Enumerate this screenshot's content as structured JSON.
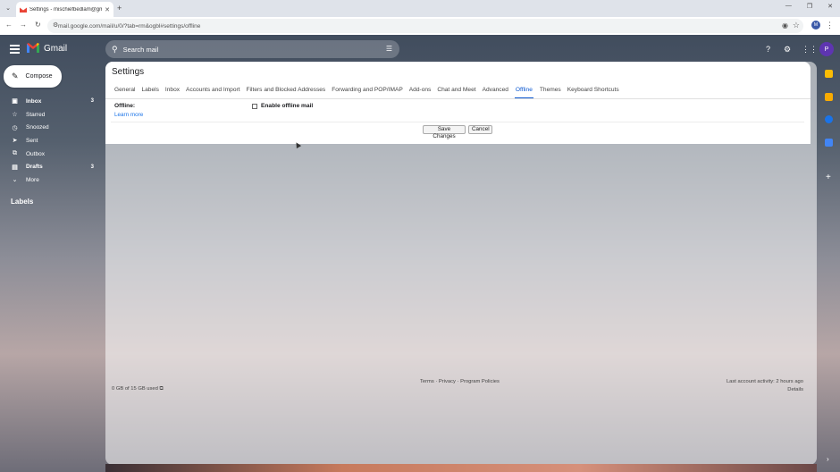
{
  "browser": {
    "tab_title": "Settings - mischiefbedlam@gm",
    "url": "mail.google.com/mail/u/0/?tab=rm&ogbl#settings/offline",
    "profile_initial": "M"
  },
  "gmail": {
    "product_name": "Gmail",
    "search_placeholder": "Search mail",
    "avatar_initial": "P",
    "compose_label": "Compose"
  },
  "nav": {
    "items": [
      {
        "label": "Inbox",
        "count": "3",
        "icon": "inbox-icon"
      },
      {
        "label": "Starred",
        "count": "",
        "icon": "star-icon"
      },
      {
        "label": "Snoozed",
        "count": "",
        "icon": "clock-icon"
      },
      {
        "label": "Sent",
        "count": "",
        "icon": "send-icon"
      },
      {
        "label": "Outbox",
        "count": "",
        "icon": "outbox-icon"
      },
      {
        "label": "Drafts",
        "count": "3",
        "icon": "draft-icon"
      },
      {
        "label": "More",
        "count": "",
        "icon": "chevron-down-icon"
      }
    ],
    "labels_heading": "Labels"
  },
  "settings": {
    "title": "Settings",
    "tabs": [
      "General",
      "Labels",
      "Inbox",
      "Accounts and Import",
      "Filters and Blocked Addresses",
      "Forwarding and POP/IMAP",
      "Add-ons",
      "Chat and Meet",
      "Advanced",
      "Offline",
      "Themes",
      "Keyboard Shortcuts"
    ],
    "active_tab": "Offline",
    "offline_label": "Offline:",
    "learn_more": "Learn more",
    "enable_offline_label": "Enable offline mail",
    "enable_offline_checked": false,
    "save_label": "Save Changes",
    "cancel_label": "Cancel"
  },
  "footer": {
    "storage": "0 GB of 15 GB used",
    "links": "Terms · Privacy · Program Policies",
    "last_activity": "Last account activity: 2 hours ago",
    "details": "Details"
  },
  "colors": {
    "accent": "#0b57d0",
    "link": "#1a73e8",
    "avatar": "#5e35b1"
  }
}
